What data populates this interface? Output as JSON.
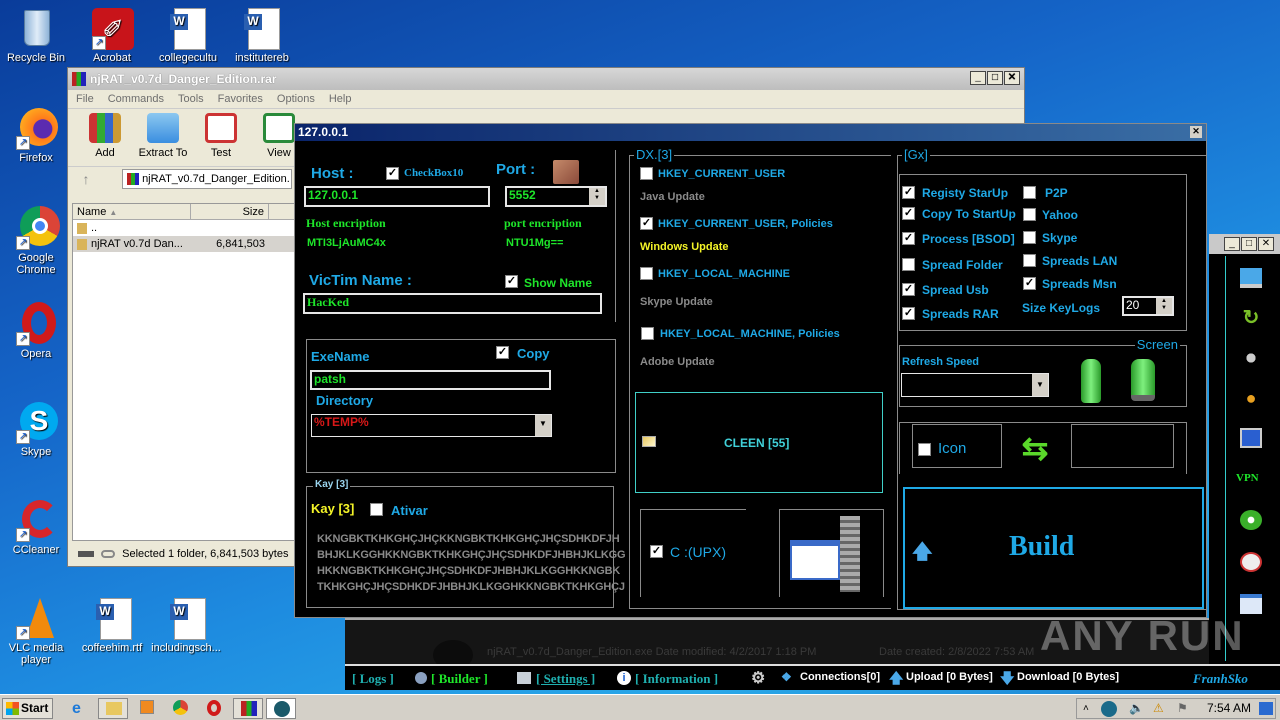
{
  "desktop": {
    "icons": [
      {
        "label": "Recycle Bin",
        "icon": "recycle-bin-icon"
      },
      {
        "label": "Acrobat",
        "icon": "acrobat-icon"
      },
      {
        "label": "collegecultu",
        "icon": "word-doc-icon"
      },
      {
        "label": "institutereb",
        "icon": "word-doc-icon"
      },
      {
        "label": "Firefox",
        "icon": "firefox-icon"
      },
      {
        "label": "Google Chrome",
        "icon": "chrome-icon"
      },
      {
        "label": "Opera",
        "icon": "opera-icon"
      },
      {
        "label": "Skype",
        "icon": "skype-icon"
      },
      {
        "label": "CCleaner",
        "icon": "ccleaner-icon"
      },
      {
        "label": "VLC media player",
        "icon": "vlc-icon"
      },
      {
        "label": "coffeehim.rtf",
        "icon": "word-doc-icon"
      },
      {
        "label": "includingsch...",
        "icon": "word-doc-icon"
      }
    ]
  },
  "winrar": {
    "title": "njRAT_v0.7d_Danger_Edition.rar",
    "menu": [
      "File",
      "Commands",
      "Tools",
      "Favorites",
      "Options",
      "Help"
    ],
    "toolbar": [
      "Add",
      "Extract To",
      "Test",
      "View"
    ],
    "address": "njRAT_v0.7d_Danger_Edition.",
    "columns": {
      "name": "Name",
      "size": "Size"
    },
    "rows": [
      {
        "name": "..",
        "size": ""
      },
      {
        "name": "njRAT v0.7d Dan...",
        "size": "6,841,503"
      }
    ],
    "status": "Selected 1 folder, 6,841,503 bytes"
  },
  "builder": {
    "title": "127.0.0.1",
    "host": {
      "label": "Host :",
      "checkbox_label": "CheckBox10",
      "checkbox_checked": true,
      "value": "127.0.0.1",
      "enc_label": "Host encription",
      "enc_value": "MTI3LjAuMC4x"
    },
    "port": {
      "label": "Port :",
      "value": "5552",
      "enc_label": "port encription",
      "enc_value": "NTU1Mg=="
    },
    "victim": {
      "label": "VicTim Name :",
      "show_label": "Show  Name",
      "show_checked": true,
      "value": "HacKed"
    },
    "exe": {
      "label": "ExeName",
      "copy_label": "Copy",
      "copy_checked": true,
      "value": "patsh",
      "dir_label": "Directory",
      "dir_value": "%TEMP%"
    },
    "kay": {
      "group": "Kay [3]",
      "label": "Kay [3]",
      "ativar_label": "Ativar",
      "ativar_checked": false,
      "lines": [
        "KKNGBKTKHKGHÇJHÇKKNGBKTKHKGHÇJHÇSDHKDFJH",
        "BHJKLKGGHKKNGBKTKHKGHÇJHÇSDHKDFJHBHJKLKGG",
        "HKKNGBKTKHKGHÇJHÇSDHKDFJHBHJKLKGGHKKNGBK",
        "TKHKGHÇJHÇSDHKDFJHBHJKLKGGHKKNGBKTKHKGHÇJ"
      ]
    },
    "dx": {
      "group": "DX.[3]",
      "items": [
        {
          "key": "HKEY_CURRENT_USER",
          "checked": false,
          "name": "Java Update",
          "active": false
        },
        {
          "key": "HKEY_CURRENT_USER, Policies",
          "checked": true,
          "name": "Windows Update",
          "active": true
        },
        {
          "key": "HKEY_LOCAL_MACHINE",
          "checked": false,
          "name": "Skype Update",
          "active": false
        },
        {
          "key": "HKEY_LOCAL_MACHINE, Policies",
          "checked": false,
          "name": "Adobe Update",
          "active": false
        }
      ],
      "cleen_label": "CLEEN [55]",
      "upx_label": "C :(UPX)",
      "upx_checked": true
    },
    "gx": {
      "group": "[Gx]",
      "left": [
        {
          "label": "Registy StarUp",
          "checked": true
        },
        {
          "label": "Copy To StartUp",
          "checked": true
        },
        {
          "label": "Process [BSOD]",
          "checked": true
        },
        {
          "label": "Spread Folder",
          "checked": false
        },
        {
          "label": "Spread Usb",
          "checked": true
        },
        {
          "label": "Spreads RAR",
          "checked": true
        }
      ],
      "right": [
        {
          "label": "P2P",
          "checked": false
        },
        {
          "label": "Yahoo",
          "checked": false
        },
        {
          "label": "Skype",
          "checked": false
        },
        {
          "label": "Spreads LAN",
          "checked": false
        },
        {
          "label": "Spreads Msn",
          "checked": true
        }
      ],
      "keylogs_label": "Size KeyLogs",
      "keylogs_value": "20"
    },
    "screen": {
      "group": "Screen",
      "refresh_label": "Refresh Speed",
      "refresh_value": ""
    },
    "icon_label": "Icon",
    "icon_checked": false,
    "build_label": "Build"
  },
  "njbar": {
    "logs": "[ Logs ]",
    "builder": "[ Builder ]",
    "settings": "[ Settings ]",
    "information": "[ Information ]",
    "connections": "Connections[0]",
    "upload": "Upload [0 Bytes]",
    "download": "Download [0 Bytes]",
    "brand": "FranhSko"
  },
  "side_panel": {
    "vpn_label": "VPN"
  },
  "behind_text": {
    "line": "njRAT_v0.7d_Danger_Edition.exe  Date modified: 4/2/2017 1:18 PM",
    "created": "Date created: 2/8/2022 7:53 AM"
  },
  "taskbar": {
    "start_label": "Start",
    "clock": "7:54 AM"
  },
  "watermark": "ANY RUN"
}
